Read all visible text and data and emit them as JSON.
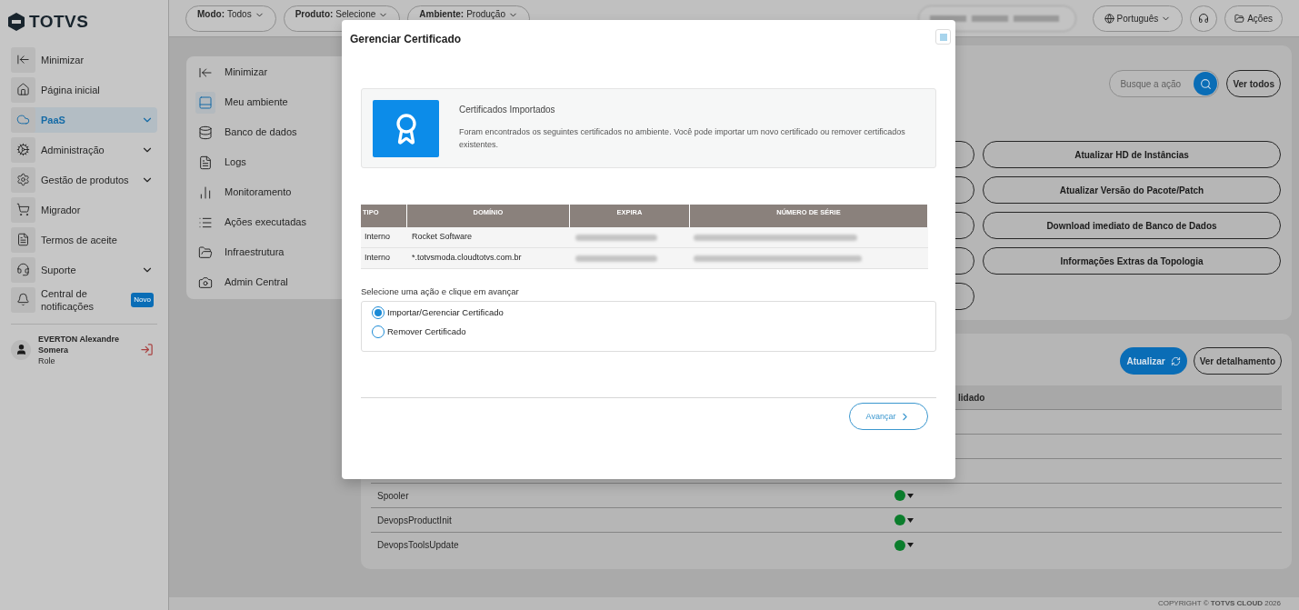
{
  "brand": {
    "name": "TOTVS"
  },
  "sidebar": {
    "items": [
      {
        "label": "Minimizar",
        "selected": false,
        "has_submenu": false
      },
      {
        "label": "Página inicial",
        "selected": false,
        "has_submenu": false
      },
      {
        "label": "PaaS",
        "selected": true,
        "has_submenu": true
      },
      {
        "label": "Administração",
        "selected": false,
        "has_submenu": true
      },
      {
        "label": "Gestão de produtos",
        "selected": false,
        "has_submenu": true
      },
      {
        "label": "Migrador",
        "selected": false,
        "has_submenu": false
      },
      {
        "label": "Termos de aceite",
        "selected": false,
        "has_submenu": false
      },
      {
        "label": "Suporte",
        "selected": false,
        "has_submenu": true
      },
      {
        "label": "Central de notificações",
        "selected": false,
        "has_submenu": false,
        "badge": "Novo"
      }
    ],
    "user": {
      "name": "EVERTON Alexandre Somera",
      "role": "Role"
    }
  },
  "topbar": {
    "filters": [
      {
        "label": "Modo:",
        "value": "Todos"
      },
      {
        "label": "Produto:",
        "value": "Selecione"
      },
      {
        "label": "Ambiente:",
        "value": "Produção"
      }
    ],
    "language": "Português",
    "actions": "Ações"
  },
  "submenu": {
    "items": [
      {
        "label": "Minimizar",
        "selected": false
      },
      {
        "label": "Meu ambiente",
        "selected": true
      },
      {
        "label": "Banco de dados",
        "selected": false
      },
      {
        "label": "Logs",
        "selected": false
      },
      {
        "label": "Monitoramento",
        "selected": false
      },
      {
        "label": "Ações executadas",
        "selected": false
      },
      {
        "label": "Infraestrutura",
        "selected": false
      },
      {
        "label": "Admin Central",
        "selected": false
      }
    ]
  },
  "actions_card": {
    "search": {
      "placeholder": "Busque a ação"
    },
    "view_all": "Ver todos",
    "buttons": [
      "Atualizar HD de Instâncias",
      "Atualizar Versão do Pacote/Patch",
      "Download imediato de Banco de Dados",
      "Informações Extras da Topologia"
    ]
  },
  "services_card": {
    "refresh": "Atualizar",
    "details": "Ver detalhamento",
    "column_2": "lidado",
    "rows": [
      {
        "name": "Spooler",
        "color": "#0b7d2c"
      },
      {
        "name": "DevopsProductInit",
        "color": "#0b7d2c"
      },
      {
        "name": "DevopsToolsUpdate",
        "color": "#0b7d2c"
      }
    ]
  },
  "modal": {
    "title": "Gerenciar Certificado",
    "info": {
      "title": "Certificados Importados",
      "text": "Foram encontrados os seguintes certificados no ambiente. Você pode importar um novo certificado ou remover certificados existentes."
    },
    "table": {
      "columns": [
        "TIPO",
        "DOMÍNIO",
        "EXPIRA",
        "NÚMERO DE SÉRIE"
      ],
      "rows": [
        {
          "tipo": "Interno",
          "dominio": "Rocket Software"
        },
        {
          "tipo": "Interno",
          "dominio": "*.totvsmoda.cloudtotvs.com.br"
        }
      ]
    },
    "prompt": "Selecione uma ação e clique em avançar",
    "options": [
      {
        "label": "Importar/Gerenciar Certificado",
        "selected": true
      },
      {
        "label": "Remover Certificado",
        "selected": false
      }
    ],
    "next": "Avançar"
  },
  "footer": {
    "copyright": "COPYRIGHT © **TOTVS CLOUD** 2026"
  }
}
